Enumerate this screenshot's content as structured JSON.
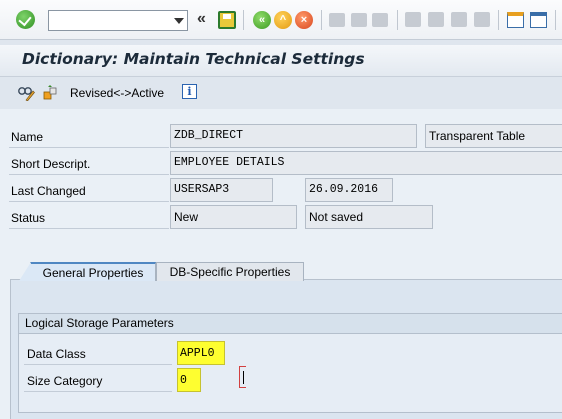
{
  "toolbar": {
    "command_field_value": "",
    "icons": [
      "ok-icon",
      "dropdown-icon",
      "collapse-icon",
      "save-icon",
      "back-icon",
      "exit-icon",
      "cancel-icon",
      "print-icon",
      "find-icon",
      "find-next-icon",
      "first-page-icon",
      "previous-page-icon",
      "next-page-icon",
      "last-page-icon",
      "create-session-icon",
      "shortcut-icon"
    ]
  },
  "title": "Dictionary: Maintain Technical Settings",
  "app_toolbar": {
    "revised_active_label": "Revised<->Active"
  },
  "fields": {
    "name": {
      "label": "Name",
      "value": "ZDB_DIRECT",
      "type_value": "Transparent Table"
    },
    "short_descript": {
      "label": "Short Descript.",
      "value": "EMPLOYEE DETAILS"
    },
    "last_changed": {
      "label": "Last Changed",
      "user": "USERSAP3",
      "date": "26.09.2016"
    },
    "status": {
      "label": "Status",
      "value": "New",
      "save_state": "Not saved"
    }
  },
  "tabs": [
    {
      "label": "General Properties",
      "active": true
    },
    {
      "label": "DB-Specific Properties",
      "active": false
    }
  ],
  "group": {
    "title": "Logical Storage Parameters",
    "data_class": {
      "label": "Data Class",
      "value": "APPL0"
    },
    "size_category": {
      "label": "Size Category",
      "value": "0"
    }
  },
  "colors": {
    "required_field": "#fefe30",
    "active_tab_border": "#4f87c2",
    "title_text": "#1c2b3a"
  }
}
